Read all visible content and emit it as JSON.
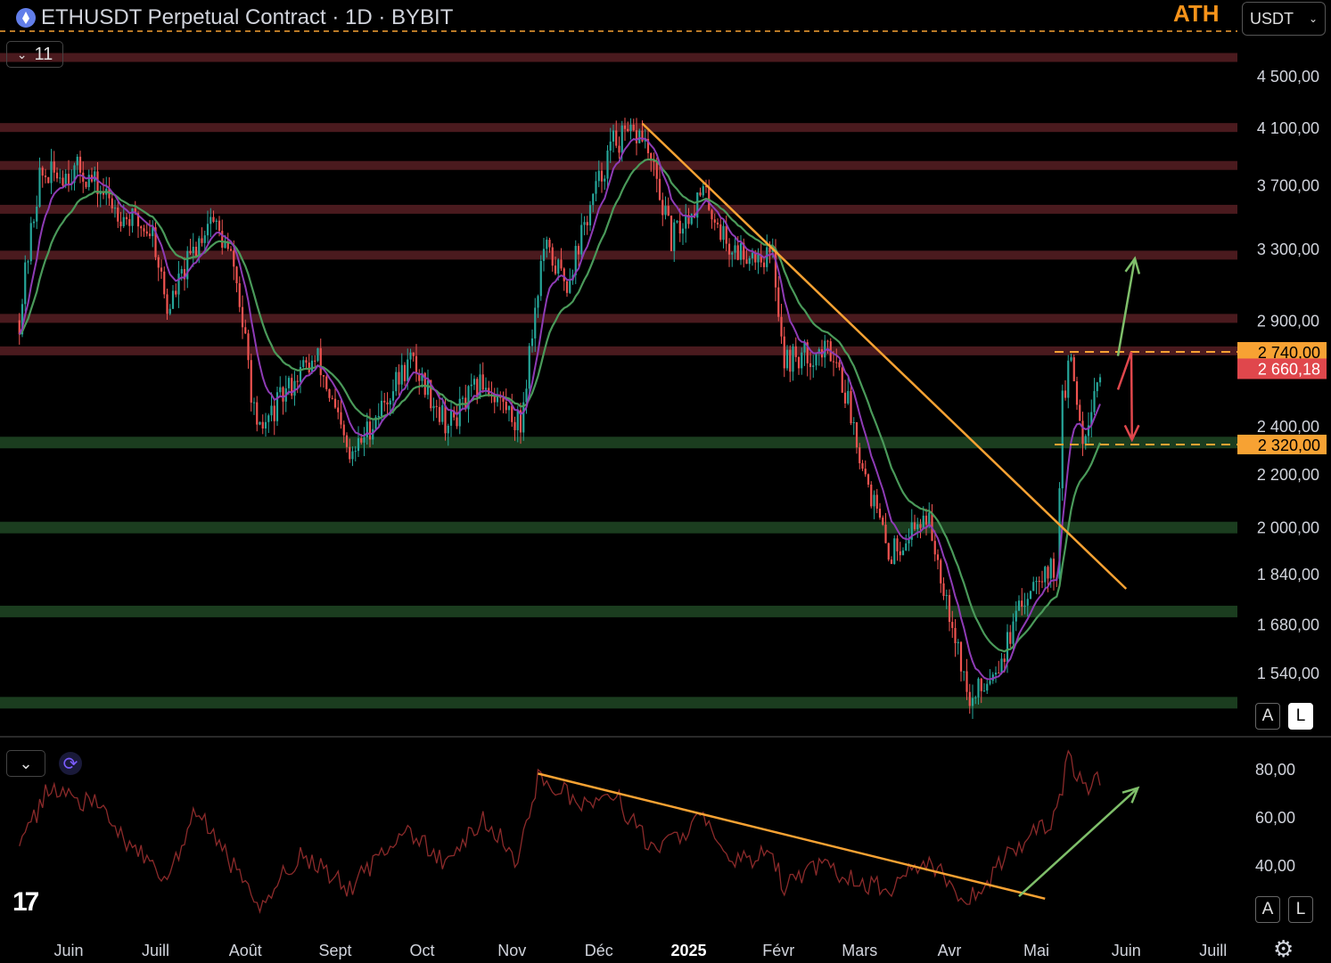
{
  "header": {
    "title": "ETHUSDT Perpetual Contract · 1D · BYBIT",
    "ath_label": "ATH",
    "currency": "USDT",
    "indicator_count": "11"
  },
  "buttons": {
    "auto": "A",
    "log": "L",
    "rsi_auto": "A",
    "rsi_log": "L"
  },
  "colors": {
    "background": "#000000",
    "resistance_zone": "#4a1a1e",
    "support_zone": "#1b3d1f",
    "trendline": "#f7a233",
    "up_arrow": "#7fbf6a",
    "down_arrow": "#e0474c",
    "rsi_line": "#8b2a2a",
    "ema_fast": "#8e3bb5",
    "ema_slow": "#4a9a5a",
    "candle_up": "#26a69a",
    "candle_down": "#ef5350"
  },
  "chart_data": [
    {
      "type": "candlestick",
      "title": "ETHUSDT Perpetual Contract · 1D · BYBIT",
      "scale": "log",
      "ylim": [
        1390,
        5000
      ],
      "y_ticks": [
        "4 500,00",
        "4 100,00",
        "3 700,00",
        "3 300,00",
        "2 900,00",
        "2 400,00",
        "2 200,00",
        "2 000,00",
        "1 840,00",
        "1 680,00",
        "1 540,00"
      ],
      "y_tick_values": [
        4500,
        4100,
        3700,
        3300,
        2900,
        2400,
        2200,
        2000,
        1840,
        1680,
        1540
      ],
      "x_ticks": [
        "Juin",
        "Juill",
        "Août",
        "Sept",
        "Oct",
        "Nov",
        "Déc",
        "2025",
        "Févr",
        "Mars",
        "Avr",
        "Mai",
        "Juin",
        "Juill"
      ],
      "x_tick_dates": [
        "2024-06-01",
        "2024-07-01",
        "2024-08-01",
        "2024-09-01",
        "2024-10-01",
        "2024-11-01",
        "2024-12-01",
        "2025-01-01",
        "2025-02-01",
        "2025-03-01",
        "2025-04-01",
        "2025-05-01",
        "2025-06-01",
        "2025-07-01"
      ],
      "price_path": [
        [
          "2024-05-15",
          2900
        ],
        [
          "2024-05-22",
          3750
        ],
        [
          "2024-06-05",
          3800
        ],
        [
          "2024-06-20",
          3500
        ],
        [
          "2024-06-30",
          3400
        ],
        [
          "2024-07-05",
          2950
        ],
        [
          "2024-07-20",
          3500
        ],
        [
          "2024-07-28",
          3200
        ],
        [
          "2024-08-05",
          2350
        ],
        [
          "2024-08-20",
          2650
        ],
        [
          "2024-08-26",
          2700
        ],
        [
          "2024-09-06",
          2250
        ],
        [
          "2024-09-20",
          2550
        ],
        [
          "2024-09-27",
          2700
        ],
        [
          "2024-10-10",
          2400
        ],
        [
          "2024-10-22",
          2600
        ],
        [
          "2024-11-04",
          2400
        ],
        [
          "2024-11-12",
          3300
        ],
        [
          "2024-11-20",
          3100
        ],
        [
          "2024-12-06",
          4000
        ],
        [
          "2024-12-16",
          4050
        ],
        [
          "2024-12-26",
          3350
        ],
        [
          "2025-01-06",
          3650
        ],
        [
          "2025-01-15",
          3300
        ],
        [
          "2025-01-30",
          3250
        ],
        [
          "2025-02-03",
          2700
        ],
        [
          "2025-02-20",
          2750
        ],
        [
          "2025-03-03",
          2200
        ],
        [
          "2025-03-11",
          1900
        ],
        [
          "2025-03-24",
          2050
        ],
        [
          "2025-04-08",
          1450
        ],
        [
          "2025-04-20",
          1600
        ],
        [
          "2025-05-01",
          1850
        ],
        [
          "2025-05-08",
          1850
        ],
        [
          "2025-05-10",
          2500
        ],
        [
          "2025-05-13",
          2700
        ],
        [
          "2025-05-17",
          2350
        ],
        [
          "2025-05-23",
          2660
        ]
      ],
      "current_price": 2660.18,
      "current_price_label": "2 660,18",
      "levels": [
        {
          "value": 2740,
          "label": "2 740,00",
          "style": "dashed"
        },
        {
          "value": 2320,
          "label": "2 320,00",
          "style": "dashed"
        }
      ],
      "resistance_zones": [
        4650,
        4100,
        3830,
        3540,
        3260,
        2910,
        2745
      ],
      "support_zones": [
        2330,
        2000,
        1720,
        1460
      ],
      "ath_line": 5000,
      "trendline": {
        "from": [
          "2024-12-16",
          4130
        ],
        "to": [
          "2025-06-01",
          1790
        ]
      },
      "scenarios": [
        {
          "direction": "up",
          "from": [
            "2025-05-23",
            2720
          ],
          "to": [
            "2025-06-04",
            3240
          ]
        },
        {
          "direction": "down",
          "from": [
            "2025-05-23",
            2740
          ],
          "to": [
            "2025-06-03",
            2340
          ]
        }
      ]
    },
    {
      "type": "line",
      "title": "",
      "ylim": [
        20,
        95
      ],
      "y_ticks": [
        "80,00",
        "60,00",
        "40,00"
      ],
      "y_tick_values": [
        80,
        60,
        40
      ],
      "rsi_path": [
        [
          "2024-05-15",
          45
        ],
        [
          "2024-05-25",
          72
        ],
        [
          "2024-06-10",
          65
        ],
        [
          "2024-06-25",
          45
        ],
        [
          "2024-07-05",
          33
        ],
        [
          "2024-07-15",
          62
        ],
        [
          "2024-07-25",
          45
        ],
        [
          "2024-08-05",
          22
        ],
        [
          "2024-08-20",
          45
        ],
        [
          "2024-09-06",
          30
        ],
        [
          "2024-09-25",
          55
        ],
        [
          "2024-10-10",
          40
        ],
        [
          "2024-10-22",
          60
        ],
        [
          "2024-11-03",
          42
        ],
        [
          "2024-11-10",
          77
        ],
        [
          "2024-11-25",
          65
        ],
        [
          "2024-12-06",
          70
        ],
        [
          "2024-12-20",
          45
        ],
        [
          "2025-01-06",
          60
        ],
        [
          "2025-01-15",
          40
        ],
        [
          "2025-01-30",
          45
        ],
        [
          "2025-02-03",
          30
        ],
        [
          "2025-02-15",
          40
        ],
        [
          "2025-03-03",
          32
        ],
        [
          "2025-03-11",
          30
        ],
        [
          "2025-03-24",
          42
        ],
        [
          "2025-04-08",
          25
        ],
        [
          "2025-04-20",
          42
        ],
        [
          "2025-05-01",
          55
        ],
        [
          "2025-05-08",
          60
        ],
        [
          "2025-05-12",
          85
        ],
        [
          "2025-05-18",
          72
        ],
        [
          "2025-05-23",
          76
        ]
      ],
      "trendline": {
        "from": [
          "2024-11-10",
          78
        ],
        "to": [
          "2025-05-04",
          26
        ]
      },
      "arrow": {
        "from": [
          "2025-04-25",
          27
        ],
        "to": [
          "2025-06-05",
          72
        ]
      }
    }
  ]
}
